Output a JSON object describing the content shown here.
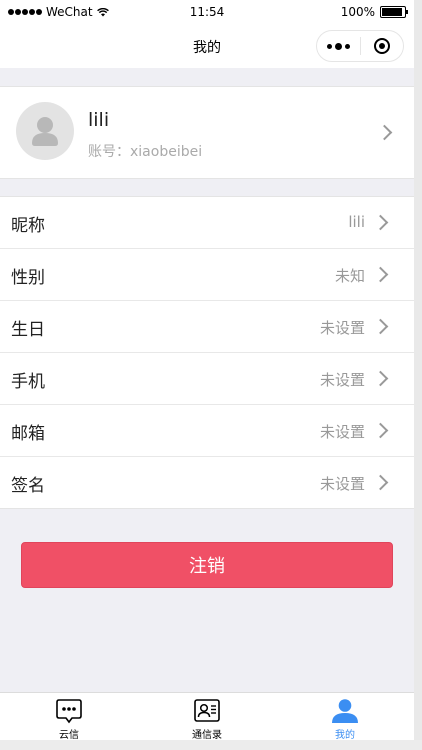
{
  "status_bar": {
    "carrier": "WeChat",
    "time": "11:54",
    "battery": "100%"
  },
  "nav": {
    "title": "我的"
  },
  "profile": {
    "name": "lili",
    "account": "账号：xiaobeibei"
  },
  "settings": [
    {
      "label": "昵称",
      "value": "lili"
    },
    {
      "label": "性别",
      "value": "未知"
    },
    {
      "label": "生日",
      "value": "未设置"
    },
    {
      "label": "手机",
      "value": "未设置"
    },
    {
      "label": "邮箱",
      "value": "未设置"
    },
    {
      "label": "签名",
      "value": "未设置"
    }
  ],
  "logout_label": "注销",
  "tabs": [
    {
      "label": "云信",
      "icon": "chat-bubble-icon",
      "active": false
    },
    {
      "label": "通信录",
      "icon": "contacts-card-icon",
      "active": false
    },
    {
      "label": "我的",
      "icon": "person-icon",
      "active": true
    }
  ],
  "colors": {
    "logout": "#f05066",
    "active_tab": "#3b8ef2"
  }
}
